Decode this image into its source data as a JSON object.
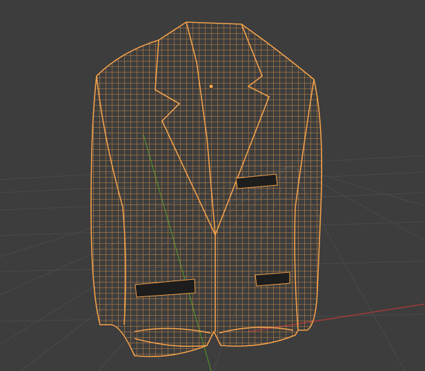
{
  "viewport": {
    "mode": "wireframe",
    "background_color": "#3d3d3d",
    "grid_color": "#4a4a4a",
    "x_axis_color": "#a23a3a",
    "y_axis_color": "#4a8a2a",
    "selection_color": "#f5a24b",
    "selected_object": "suit-jacket-mesh",
    "origin_icon": "object-origin-dot"
  }
}
